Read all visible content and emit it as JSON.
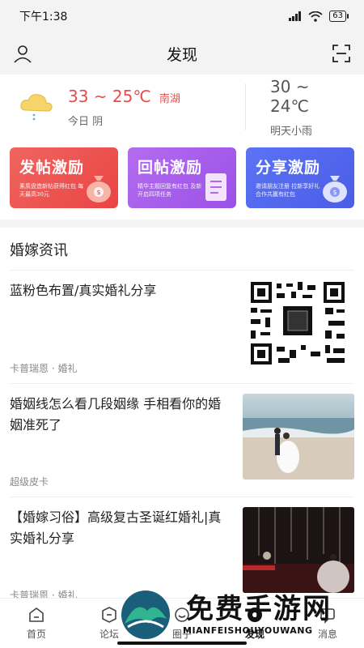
{
  "status": {
    "time": "下午1:38",
    "battery": "63"
  },
  "header": {
    "title": "发现",
    "profile_icon": "person-icon",
    "scan_icon": "scan-icon"
  },
  "weather": {
    "today_temp": "33 ~ 25℃",
    "city": "南湖",
    "today_label": "今日 阴",
    "tomorrow_temp": "30 ~ 24℃",
    "tomorrow_label": "明天小雨"
  },
  "promos": [
    {
      "title": "发帖激励",
      "subtitle": "素质盘造新帖获得红包\n每天最高30元",
      "color": "#ea4a48"
    },
    {
      "title": "回帖激励",
      "subtitle": "精华主题回复有红包\n及新开启四项任务",
      "color": "#a45ce9"
    },
    {
      "title": "分享激励",
      "subtitle": "邀请朋友注册 拉新享好礼\n合作共赢有红包",
      "color": "#4f63ea"
    }
  ],
  "news": {
    "section_title": "婚嫁资讯",
    "items": [
      {
        "title": "蓝粉色布置/真实婚礼分享",
        "meta": "卡普瑞恩 · 婚礼"
      },
      {
        "title": "婚姻线怎么看几段姻缘 手相看你的婚姻准死了",
        "meta": "超级皮卡"
      },
      {
        "title": "【婚嫁习俗】高级复古圣诞红婚礼|真实婚礼分享",
        "meta": "卡普瑞恩 · 婚礼"
      }
    ]
  },
  "tabs": [
    {
      "label": "首页",
      "icon": "home-icon"
    },
    {
      "label": "论坛",
      "icon": "forum-icon"
    },
    {
      "label": "圈子",
      "icon": "circle-icon"
    },
    {
      "label": "发现",
      "icon": "discover-icon"
    },
    {
      "label": "消息",
      "icon": "message-icon"
    }
  ],
  "watermark": {
    "text": "免费手游网",
    "sub": "MIANFEISHOUYOUWANG"
  }
}
